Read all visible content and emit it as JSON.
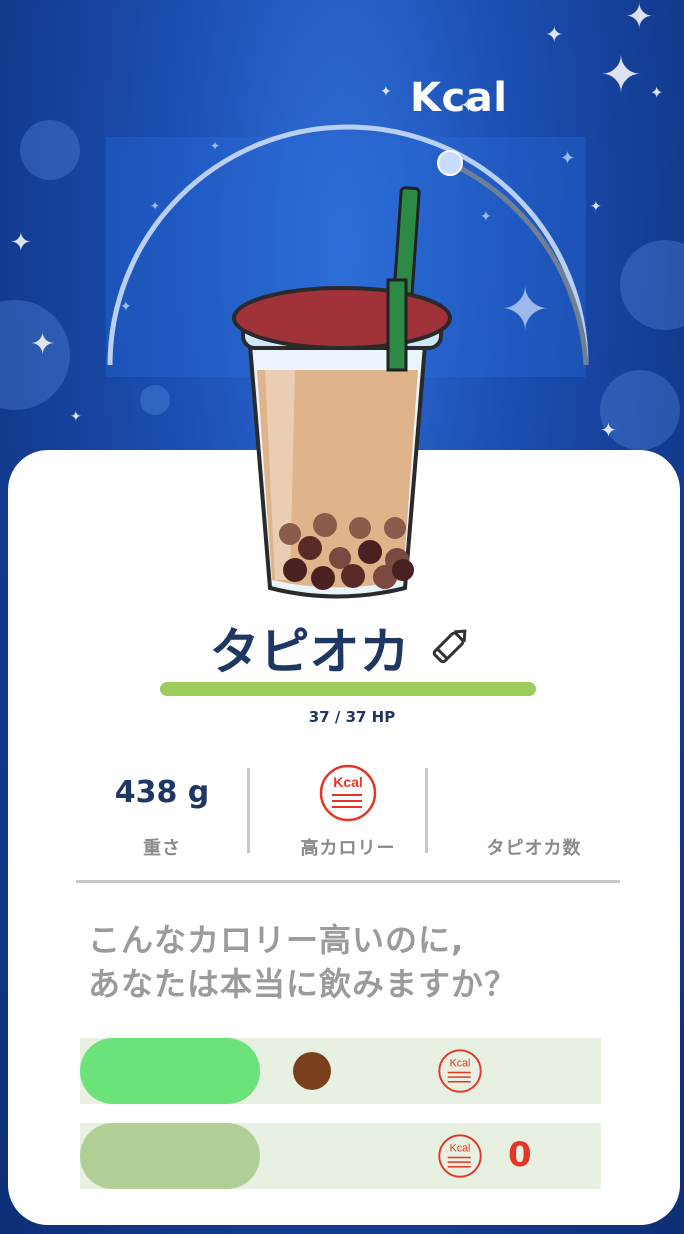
{
  "header": {
    "title": "Kcal"
  },
  "drink": {
    "name": "タピオカ",
    "hp_current": 37,
    "hp_max": 37,
    "hp_text": "37 / 37 HP"
  },
  "stats": {
    "weight_value": "438 g",
    "weight_label": "重さ",
    "calorie_icon_text": "Kcal",
    "calorie_label": "高カロリー",
    "tapioca_label": "タピオカ数",
    "tapioca_value": ""
  },
  "question": {
    "line1": "こんなカロリー高いのに,",
    "line2": "あなたは本当に飲みますか？"
  },
  "options": [
    {
      "pill_color": "#6be27a",
      "icon_text": "Kcal"
    },
    {
      "pill_color": "#b0cf94",
      "icon_text": "Kcal",
      "count": "0"
    }
  ],
  "colors": {
    "accent_navy": "#1f3763",
    "hp_green": "#9ccc5a",
    "calorie_red": "#e53525",
    "option_bg": "#e7f0e1"
  }
}
